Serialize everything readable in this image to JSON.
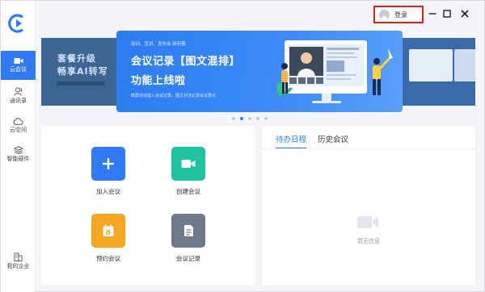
{
  "titlebar": {
    "login_label": "登录"
  },
  "sidebar": {
    "items": [
      {
        "label": "云会议",
        "icon": "video-camera-icon",
        "active": true
      },
      {
        "label": "通讯录",
        "icon": "contacts-icon",
        "active": false
      },
      {
        "label": "云空间",
        "icon": "cloud-icon",
        "active": false
      },
      {
        "label": "智能硬件",
        "icon": "hardware-icon",
        "active": false
      },
      {
        "label": "我的企业",
        "icon": "building-icon",
        "active": false
      }
    ]
  },
  "banner": {
    "left_text_1": "套餐升级",
    "left_text_2": "畅享AI转写",
    "top_small": "培训、宣讲、发布会 新利器",
    "headline_1": "会议记录【图文混排】",
    "headline_2": "功能上线啦",
    "bottom_small": "截屏自动插入会议记录，图文并茂记录会议要点",
    "dots_count": 5,
    "active_dot": 1
  },
  "actions": [
    {
      "label": "加入会议",
      "icon": "plus-icon",
      "color": "#2f7bf5"
    },
    {
      "label": "创建会议",
      "icon": "camera-icon",
      "color": "#1fc3a0"
    },
    {
      "label": "预约会议",
      "icon": "calendar-icon",
      "color": "#f5a623",
      "calendar_number": "8"
    },
    {
      "label": "会议记录",
      "icon": "document-icon",
      "color": "#6e7a8a"
    }
  ],
  "schedule": {
    "tabs": [
      "待办日程",
      "历史会议"
    ],
    "active_tab": 0,
    "empty_text": "暂无信息"
  },
  "colors": {
    "accent": "#2f7bf5",
    "login_highlight": "#e02020"
  }
}
